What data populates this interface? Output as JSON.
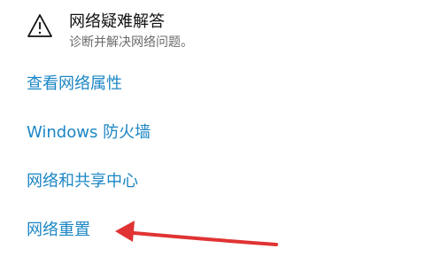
{
  "troubleshoot": {
    "icon": "warning-icon",
    "title": "网络疑难解答",
    "subtitle": "诊断并解决网络问题。"
  },
  "links": [
    {
      "label": "查看网络属性"
    },
    {
      "label": "Windows 防火墙"
    },
    {
      "label": "网络和共享中心"
    },
    {
      "label": "网络重置"
    }
  ],
  "colors": {
    "link": "#1b86c5",
    "arrow": "#e03333",
    "title": "#111111",
    "subtitle": "#6b6b6b"
  }
}
